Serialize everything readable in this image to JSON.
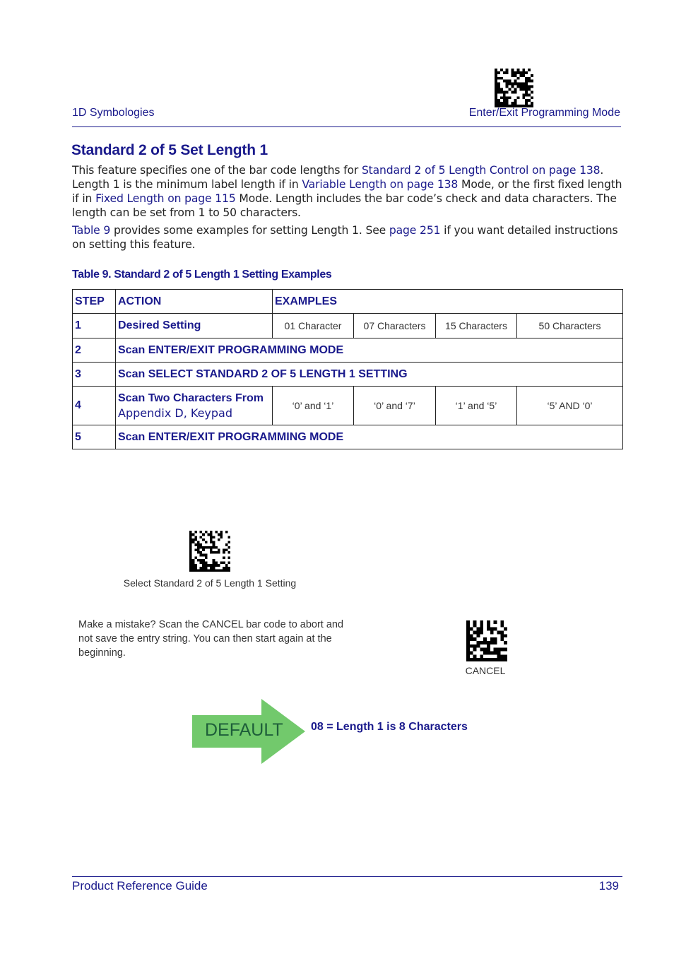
{
  "header": {
    "section": "1D Symbologies",
    "barcode_label": "Enter/Exit Programming Mode"
  },
  "title": "Standard 2 of 5 Set Length 1",
  "intro": {
    "t1": "This feature specifies one of the bar code lengths for ",
    "link1": "Standard 2 of 5 Length Control on page 138",
    "t2": ". Length 1 is the minimum label length if in ",
    "link2": "Variable Length on page 138",
    "t3": " Mode, or the first fixed length if in ",
    "link3": "Fixed Length on page 115",
    "t4": " Mode. Length includes the bar code’s check and data characters. The length can be set from 1 to 50 characters."
  },
  "note": {
    "link1": "Table 9",
    "t1": " provides some examples for setting Length 1. See ",
    "link2": "page 251",
    "t2": " if you want detailed instructions on setting this feature."
  },
  "table": {
    "caption": "Table 9. Standard 2 of 5 Length 1 Setting Examples",
    "headers": [
      "STEP",
      "ACTION",
      "EXAMPLES"
    ],
    "rows": [
      {
        "step": "1",
        "action": "Desired Setting",
        "examples": [
          "01 Character",
          "07 Characters",
          "15 Characters",
          "50 Characters"
        ]
      },
      {
        "step": "2",
        "action": "Scan ENTER/EXIT PROGRAMMING MODE"
      },
      {
        "step": "3",
        "action": "Scan SELECT STANDARD 2 OF 5 LENGTH 1 SETTING"
      },
      {
        "step": "4",
        "action": "Scan Two Characters From",
        "action_link": "Appendix D, Keypad",
        "examples": [
          "‘0’ and ‘1’",
          "‘0’ and ‘7’",
          "‘1’ and ‘5’",
          "‘5’ AND ‘0’"
        ]
      },
      {
        "step": "5",
        "action": "Scan ENTER/EXIT PROGRAMMING MODE"
      }
    ]
  },
  "barcodes": {
    "select_label": "Select Standard 2 of 5 Length 1 Setting",
    "cancel_label": "CANCEL"
  },
  "mistake_text": "Make a mistake? Scan the CANCEL bar code to abort and not save the entry string. You can then start again at the beginning.",
  "default": {
    "label": "DEFAULT",
    "text": "08 = Length 1 is 8 Characters",
    "color": "#72c96c"
  },
  "footer": {
    "guide": "Product Reference Guide",
    "page": "139"
  }
}
